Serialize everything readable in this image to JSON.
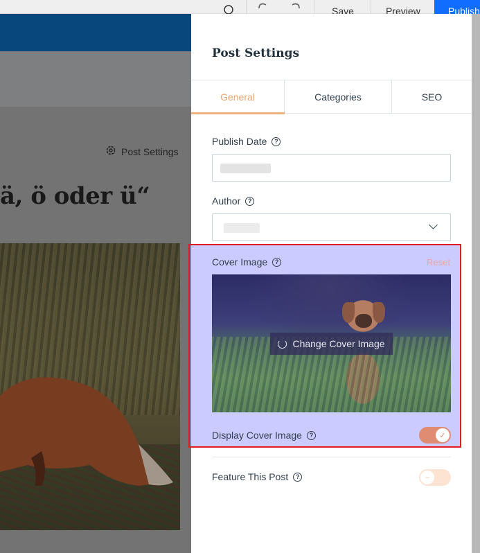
{
  "toolbar": {
    "save_label": "Save",
    "preview_label": "Preview",
    "publish_label": "Publish",
    "icons": [
      "search-icon",
      "undo-icon",
      "redo-icon"
    ]
  },
  "editor": {
    "post_settings_link": "Post Settings",
    "post_title_fragment": "ä, ö oder ü“"
  },
  "panel": {
    "title": "Post Settings",
    "tabs": [
      {
        "label": "General",
        "active": true
      },
      {
        "label": "Categories",
        "active": false
      },
      {
        "label": "SEO",
        "active": false
      }
    ],
    "publish_date": {
      "label": "Publish Date",
      "value": ""
    },
    "author": {
      "label": "Author",
      "value": ""
    },
    "cover_image": {
      "label": "Cover Image",
      "reset_label": "Reset",
      "change_label": "Change Cover Image"
    },
    "display_cover_image": {
      "label": "Display Cover Image",
      "checked": true
    },
    "feature_this_post": {
      "label": "Feature This Post",
      "checked": false
    },
    "help_glyph": "?"
  },
  "colors": {
    "accent": "#e8a46c",
    "toggle_on": "#e08c72",
    "highlight_border": "#e11b22",
    "publish_bg": "#116dff"
  }
}
